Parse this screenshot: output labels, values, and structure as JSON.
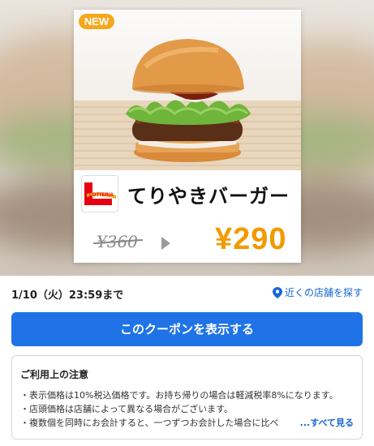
{
  "coupon": {
    "badge": "NEW",
    "product_name": "てりやきバーガー",
    "original_price": "¥360",
    "coupon_price": "¥290",
    "brand_logo_text": "LOTTERIA"
  },
  "info": {
    "deadline": "1/10（火）23:59まで",
    "nearby_stores": "近くの店舗を探す"
  },
  "actions": {
    "show_coupon": "このクーポンを表示する"
  },
  "notes": {
    "title": "ご利用上の注意",
    "items": [
      "表示価格は10%税込価格です。お持ち帰りの場合は軽減税率8%になります。",
      "店頭価格は店舗によって異なる場合がございます。",
      "複数個を同時にお会計すると、一つずつお会計した場合に比べ"
    ],
    "see_all": "...すべて見る"
  },
  "colors": {
    "accent_blue": "#1f73e6",
    "price_orange": "#f39a00",
    "badge_orange": "#f6a81b"
  },
  "icons": [
    "map-pin-icon",
    "arrow-right-icon"
  ]
}
